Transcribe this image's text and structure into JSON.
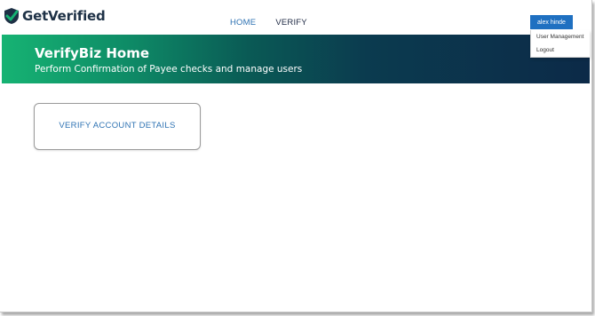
{
  "header": {
    "logo_text": "GetVerified",
    "nav": [
      {
        "label": "HOME"
      },
      {
        "label": "VERIFY"
      }
    ],
    "user": {
      "name": "alex hinde",
      "menu": [
        {
          "label": "User Management"
        },
        {
          "label": "Logout"
        }
      ]
    }
  },
  "hero": {
    "title": "VerifyBiz Home",
    "subtitle": "Perform Confirmation of Payee checks and manage users"
  },
  "main": {
    "card_label": "VERIFY ACCOUNT DETAILS"
  },
  "colors": {
    "brand_navy": "#1e3146",
    "brand_green": "#16b373",
    "link_blue": "#2f73b3",
    "button_blue": "#1f70c1"
  },
  "icons": {
    "logo": "check-shield-logo-icon"
  }
}
